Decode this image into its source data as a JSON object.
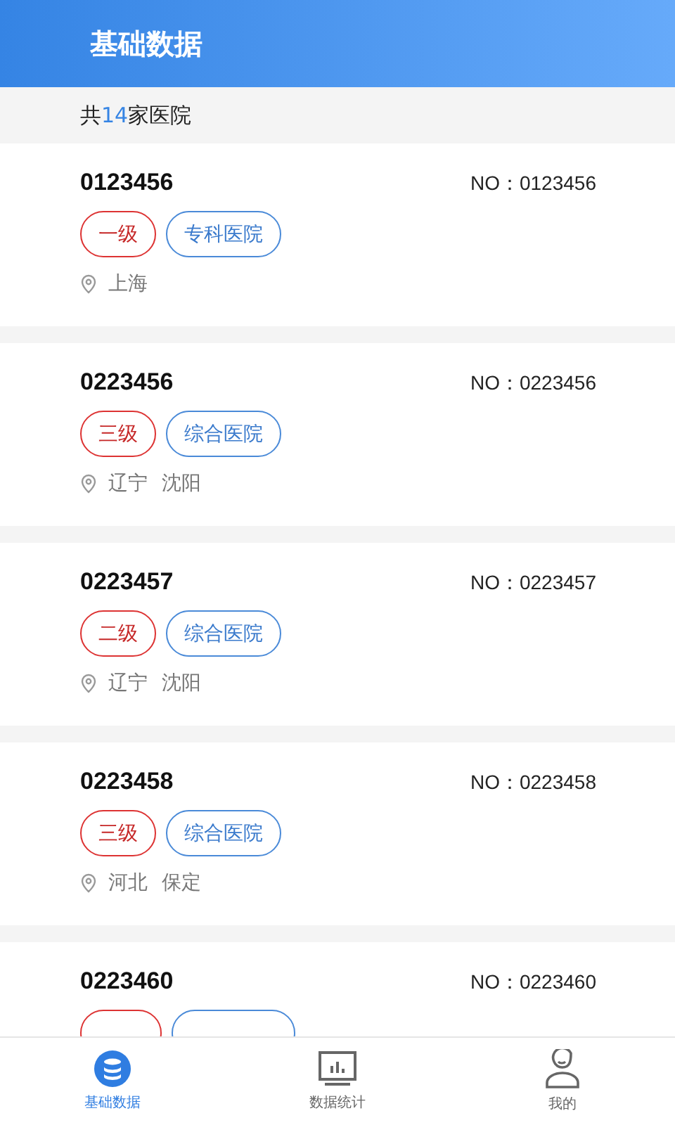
{
  "header": {
    "title": "基础数据"
  },
  "summary": {
    "prefix": "共",
    "count": "14",
    "suffix": "家医院"
  },
  "hospitals": [
    {
      "name": "0123456",
      "number": "NO：0123456",
      "tags": [
        {
          "kind": "grade",
          "label": "一级"
        },
        {
          "kind": "type",
          "label": "专科医院"
        }
      ],
      "location": [
        "上海"
      ]
    },
    {
      "name": "0223456",
      "number": "NO：0223456",
      "tags": [
        {
          "kind": "grade",
          "label": "三级"
        },
        {
          "kind": "type",
          "label": "综合医院"
        }
      ],
      "location": [
        "辽宁",
        "沈阳"
      ]
    },
    {
      "name": "0223457",
      "number": "NO：0223457",
      "tags": [
        {
          "kind": "grade",
          "label": "二级"
        },
        {
          "kind": "type",
          "label": "综合医院"
        }
      ],
      "location": [
        "辽宁",
        "沈阳"
      ]
    },
    {
      "name": "0223458",
      "number": "NO：0223458",
      "tags": [
        {
          "kind": "grade",
          "label": "三级"
        },
        {
          "kind": "type",
          "label": "综合医院"
        }
      ],
      "location": [
        "河北",
        "保定"
      ]
    },
    {
      "name": "0223460",
      "number": "NO：0223460",
      "tags": [
        {
          "kind": "grade"
        },
        {
          "kind": "type"
        }
      ]
    }
  ],
  "tab_bar": [
    {
      "kind": "database",
      "label": "基础数据",
      "selected": true
    },
    {
      "kind": "stats",
      "label": "数据统计",
      "selected": false
    },
    {
      "kind": "person",
      "label": "我的",
      "selected": false
    }
  ]
}
